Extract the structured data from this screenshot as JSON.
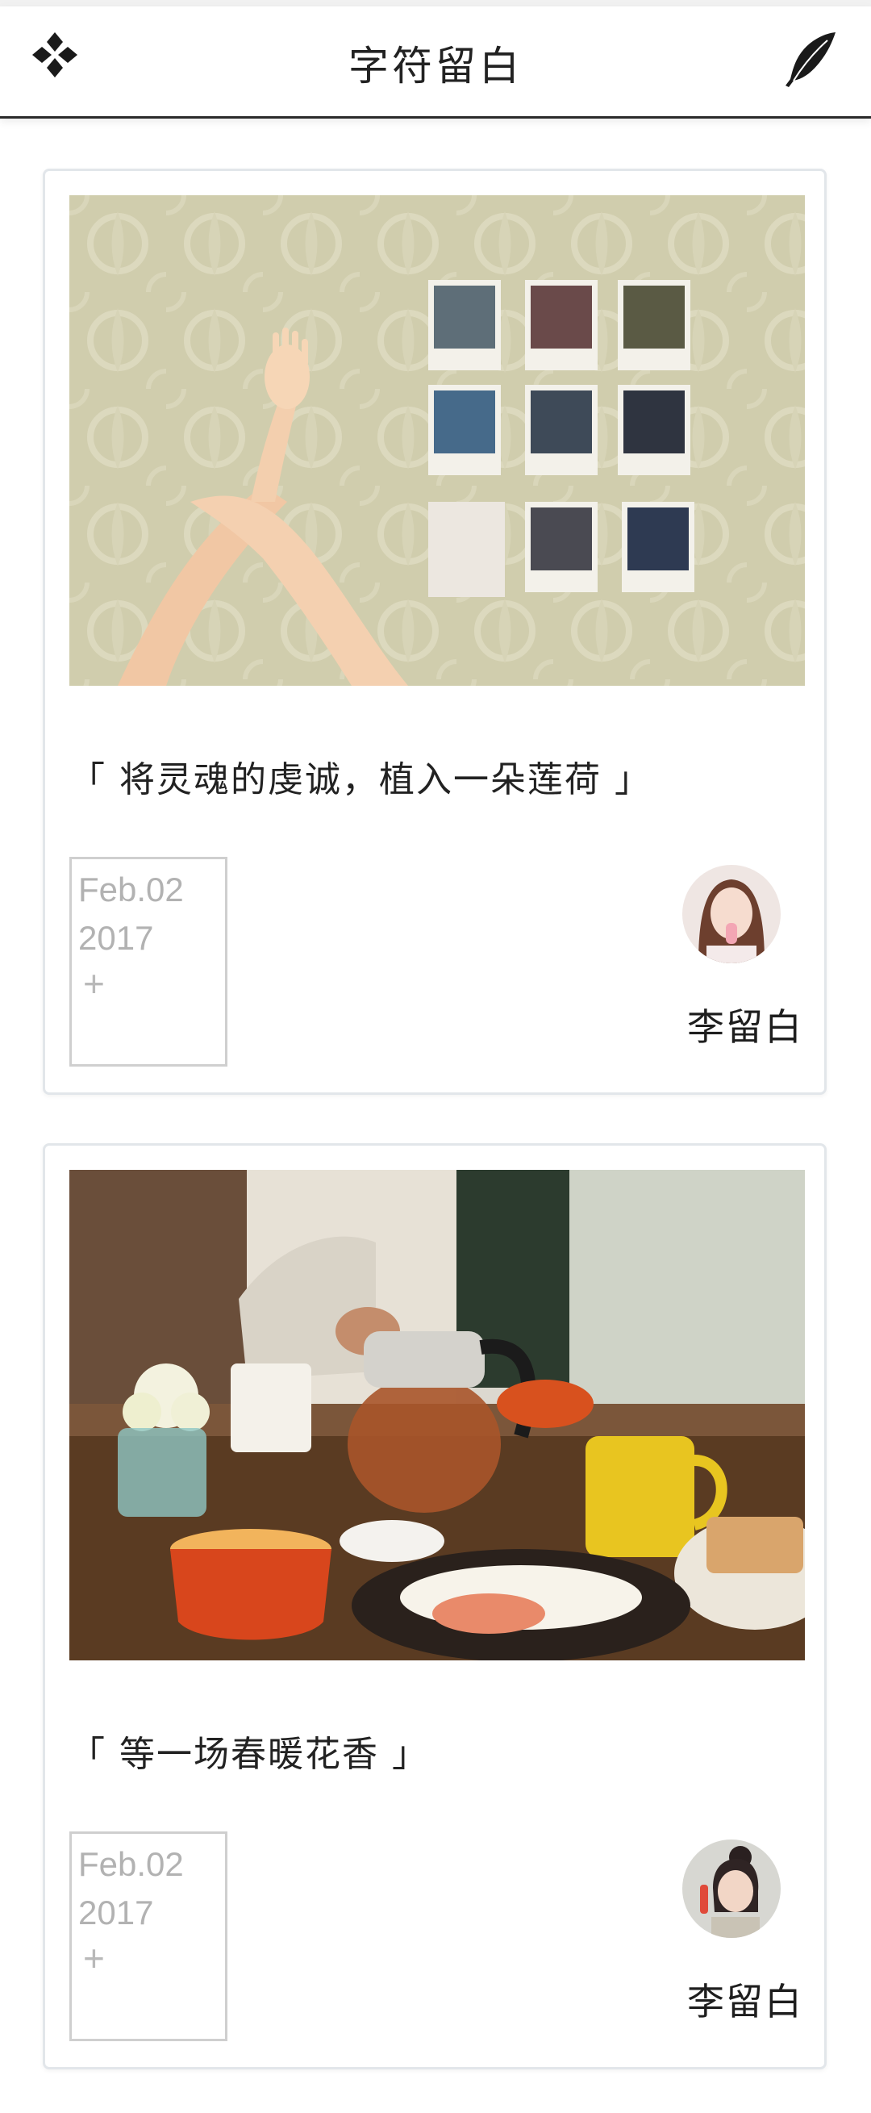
{
  "header": {
    "title": "字符留白",
    "menu_icon": "four-diamond-menu-icon",
    "write_icon": "feather-icon"
  },
  "posts": [
    {
      "photo": "polaroid-wall-with-arms",
      "quote": "「 将灵魂的虔诚，植入一朵莲荷 」",
      "date_line1": "Feb.02",
      "date_line2": "2017",
      "plus": "+",
      "author": "李留白"
    },
    {
      "photo": "breakfast-table-with-teapot",
      "quote": "「 等一场春暖花香 」",
      "date_line1": "Feb.02",
      "date_line2": "2017",
      "plus": "+",
      "author": "李留白"
    }
  ],
  "colors": {
    "header_border": "#2b2b2b",
    "card_border": "#e2e6ea",
    "date_text": "#b2b2b2"
  }
}
